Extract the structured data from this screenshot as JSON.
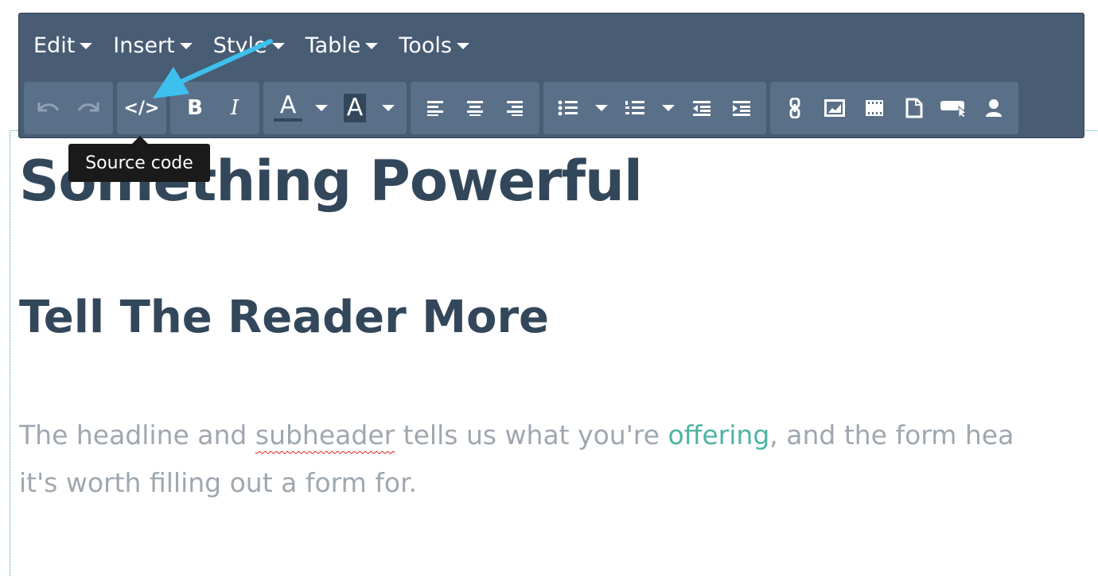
{
  "menubar": {
    "items": [
      {
        "label": "Edit"
      },
      {
        "label": "Insert"
      },
      {
        "label": "Style"
      },
      {
        "label": "Table"
      },
      {
        "label": "Tools"
      }
    ]
  },
  "toolbar": {
    "undo_icon": "undo-icon",
    "redo_icon": "redo-icon",
    "source_code_label": "</>",
    "bold_label": "B",
    "italic_label": "I",
    "text_color_label": "A",
    "background_color_label": "A"
  },
  "tooltip": {
    "text": "Source code"
  },
  "content": {
    "headline": "Something Powerful",
    "subheader": "Tell The Reader More",
    "body_part1": "The headline and ",
    "body_misspelled": "subheader",
    "body_part2": " tells us what you're ",
    "body_link": "offering",
    "body_part3": ", and the form hea",
    "body_line2": "it's worth filling out a form for."
  },
  "colors": {
    "toolbar_bg": "#485c74",
    "button_group_bg": "#5a7089",
    "heading_text": "#33475b",
    "body_text": "#9fa7b0",
    "link": "#4fb3a3",
    "arrow": "#3ec0ef"
  }
}
